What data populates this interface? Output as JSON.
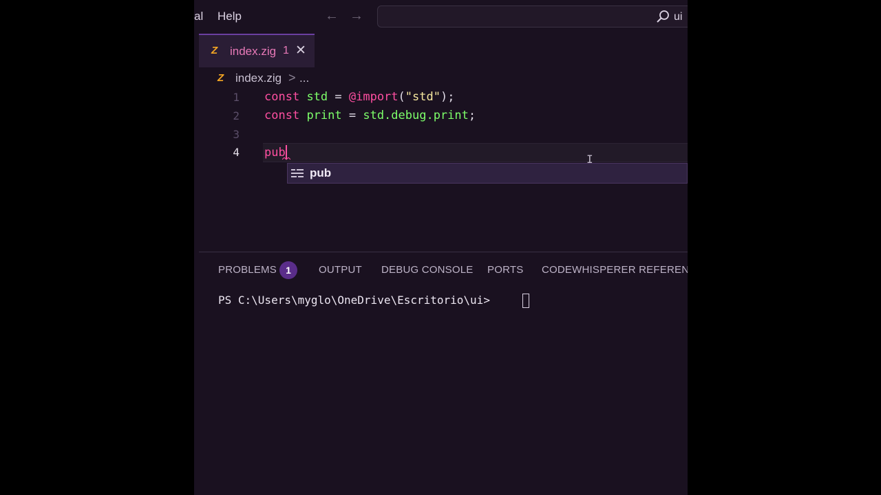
{
  "menu": {
    "partial_item": "al",
    "help": "Help"
  },
  "nav": {
    "back_icon": "arrow-left-icon",
    "forward_icon": "arrow-right-icon"
  },
  "search": {
    "text": "ui",
    "icon": "search-icon"
  },
  "tab": {
    "icon": "zig-icon",
    "icon_glyph": "Z",
    "label": "index.zig",
    "badge": "1",
    "close": "✕"
  },
  "breadcrumb": {
    "icon_glyph": "Z",
    "file": "index.zig",
    "separator": ">",
    "more": "..."
  },
  "editor": {
    "line_numbers": [
      "1",
      "2",
      "3",
      "4"
    ],
    "active_line": "4",
    "line1": {
      "kw": "const",
      "id": "std",
      "eq": " = ",
      "fn": "@import",
      "open": "(",
      "str": "\"std\"",
      "close": ");"
    },
    "line2": {
      "kw": "const",
      "id": "print",
      "eq": " = ",
      "obj": "std.debug.print",
      "end": ";"
    },
    "line4": {
      "text": "pub"
    }
  },
  "suggest": {
    "icon": "keyword-icon",
    "label": "pub"
  },
  "panel": {
    "tabs": [
      "PROBLEMS",
      "OUTPUT",
      "DEBUG CONSOLE",
      "PORTS",
      "CODEWHISPERER REFERENCE L"
    ],
    "problems_count": "1"
  },
  "terminal": {
    "prompt": "PS C:\\Users\\myglo\\OneDrive\\Escritorio\\ui>"
  },
  "colors": {
    "background": "#1a1120",
    "keyword": "#ff4fa1",
    "identifier": "#7dff6a",
    "string": "#f5e79e",
    "zig_icon": "#f5a623",
    "badge": "#5a2d8a"
  }
}
